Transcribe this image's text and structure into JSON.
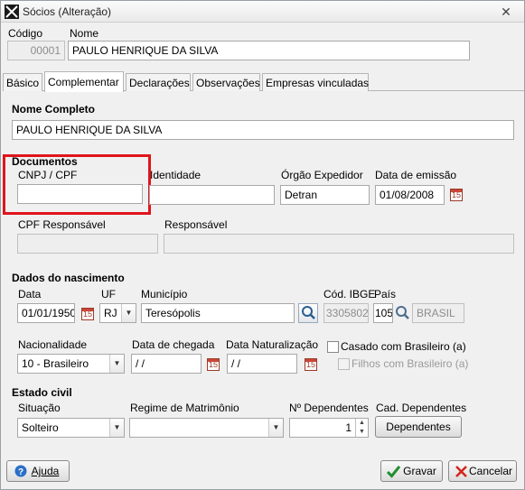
{
  "window": {
    "title": "Sócios (Alteração)"
  },
  "header": {
    "codigo_label": "Código",
    "codigo_value": "00001",
    "nome_label": "Nome",
    "nome_value": "PAULO HENRIQUE DA SILVA"
  },
  "tabs": [
    {
      "label": "Básico"
    },
    {
      "label": "Complementar"
    },
    {
      "label": "Declarações"
    },
    {
      "label": "Observações"
    },
    {
      "label": "Empresas vinculadas"
    }
  ],
  "nome_completo": {
    "label": "Nome Completo",
    "value": "PAULO HENRIQUE DA SILVA"
  },
  "documentos": {
    "section_label": "Documentos",
    "cnpj_label": "CNPJ / CPF",
    "cnpj_value": "",
    "identidade_label": "Identidade",
    "identidade_value": "",
    "orgao_label": "Órgão Expedidor",
    "orgao_value": "Detran",
    "data_emissao_label": "Data de emissão",
    "data_emissao_value": "01/08/2008",
    "cpf_resp_label": "CPF Responsável",
    "responsavel_label": "Responsável"
  },
  "nascimento": {
    "section_label": "Dados do nascimento",
    "data_label": "Data",
    "data_value": "01/01/1950",
    "uf_label": "UF",
    "uf_value": "RJ",
    "municipio_label": "Município",
    "municipio_value": "Teresópolis",
    "cod_ibge_label": "Cód. IBGE",
    "cod_ibge_value": "3305802",
    "pais_label": "País",
    "pais_code": "105",
    "pais_name": "BRASIL",
    "nacionalidade_label": "Nacionalidade",
    "nacionalidade_value": "10 - Brasileiro",
    "data_chegada_label": "Data de chegada",
    "data_chegada_value": " / /",
    "data_naturalizacao_label": "Data Naturalização",
    "data_naturalizacao_value": " / /",
    "casado_label": "Casado com Brasileiro (a)",
    "filhos_label": "Filhos com Brasileiro (a)"
  },
  "estado_civil": {
    "section_label": "Estado civil",
    "situacao_label": "Situação",
    "situacao_value": "Solteiro",
    "regime_label": "Regime de Matrimônio",
    "regime_value": "",
    "dependentes_label": "Nº Dependentes",
    "dependentes_value": "1",
    "cad_dependentes_label": "Cad. Dependentes",
    "dependentes_button": "Dependentes"
  },
  "footer": {
    "ajuda_button": "Ajuda",
    "gravar_button": "Gravar",
    "cancelar_button": "Cancelar"
  }
}
